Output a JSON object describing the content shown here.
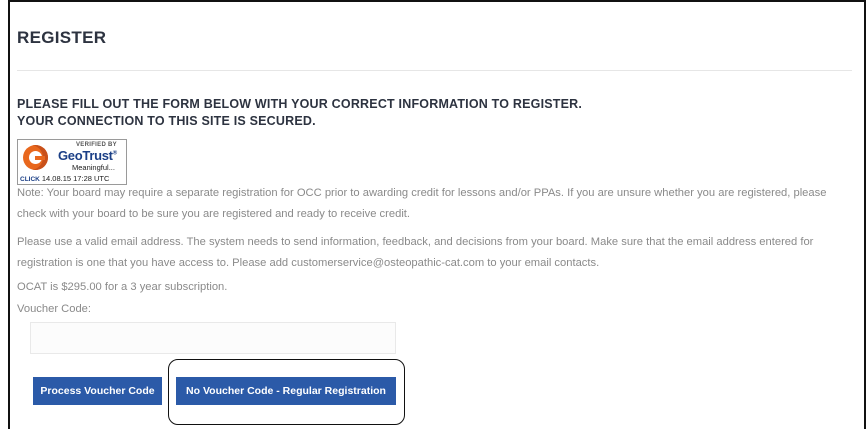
{
  "page": {
    "title": "REGISTER",
    "heading_line1": "PLEASE FILL OUT THE FORM BELOW WITH YOUR CORRECT INFORMATION TO REGISTER.",
    "heading_line2": "YOUR CONNECTION TO THIS SITE IS SECURED."
  },
  "seal": {
    "verified_by": "VERIFIED BY",
    "brand_geo": "Geo",
    "brand_trust": "Trust",
    "brand_mark": "®",
    "meaningful": "Meaningful...",
    "click": "CLICK",
    "timestamp": "14.08.15 17:28 UTC"
  },
  "notes": {
    "note": "Note:  Your board may require a separate registration for OCC prior to awarding credit for lessons and/or PPAs. If you are unsure whether you are registered, please check with your board to be sure you are registered and ready to receive credit.",
    "email": "Please use a valid email address. The system needs to send information, feedback, and decisions from your board. Make sure that the email address entered for registration is one that you have access to. Please add customerservice@osteopathic-cat.com to your email contacts.",
    "price": "OCAT is $295.00 for a 3 year subscription."
  },
  "form": {
    "voucher_label": "Voucher Code:",
    "voucher_value": "",
    "voucher_placeholder": ""
  },
  "buttons": {
    "process": "Process Voucher Code",
    "no_voucher": "No Voucher Code - Regular Registration"
  },
  "colors": {
    "button_bg": "#2b5aa8",
    "heading": "#2d3340",
    "body_text": "#8a8a8a"
  }
}
